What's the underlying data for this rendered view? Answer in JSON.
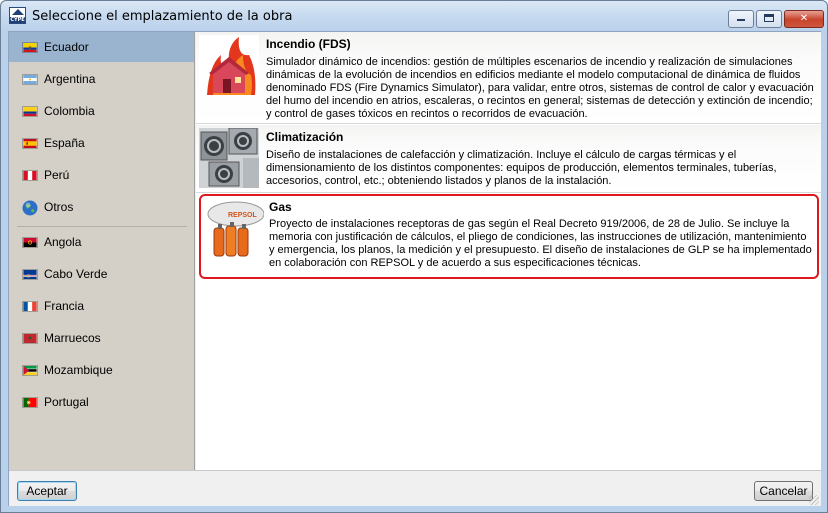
{
  "window": {
    "title": "Seleccione el emplazamiento de la obra",
    "icon": "app-logo-icon",
    "icon_text": "CYPE",
    "buttons": {
      "minimize": "minimize",
      "maximize": "maximize",
      "close": "✕"
    }
  },
  "sidebar": {
    "items": [
      {
        "label": "Ecuador",
        "flag": "ecuador-flag-icon",
        "selected": true
      },
      {
        "label": "Argentina",
        "flag": "argentina-flag-icon"
      },
      {
        "label": "Colombia",
        "flag": "colombia-flag-icon"
      },
      {
        "label": "España",
        "flag": "spain-flag-icon"
      },
      {
        "label": "Perú",
        "flag": "peru-flag-icon"
      },
      {
        "label": "Otros",
        "flag": "globe-icon"
      },
      {
        "label": "Angola",
        "flag": "angola-flag-icon"
      },
      {
        "label": "Cabo Verde",
        "flag": "cape-verde-flag-icon"
      },
      {
        "label": "Francia",
        "flag": "france-flag-icon"
      },
      {
        "label": "Marruecos",
        "flag": "morocco-flag-icon"
      },
      {
        "label": "Mozambique",
        "flag": "mozambique-flag-icon"
      },
      {
        "label": "Portugal",
        "flag": "portugal-flag-icon"
      }
    ]
  },
  "modules": [
    {
      "title": "Incendio (FDS)",
      "icon": "burning-house-icon",
      "description": "Simulador dinámico de incendios: gestión de múltiples escenarios de incendio y realización de simulaciones dinámicas de la evolución de incendios en edificios mediante el modelo computacional de dinámica de fluidos denominado FDS (Fire Dynamics Simulator), para validar, entre otros, sistemas de control de calor y evacuación del humo del incendio en atrios, escaleras, o recintos en general; sistemas de detección y extinción de incendio; y control de gases tóxicos en recintos o recorridos de evacuación."
    },
    {
      "title": "Climatización",
      "icon": "hvac-units-icon",
      "description": "Diseño de instalaciones de calefacción y climatización. Incluye el cálculo de cargas térmicas y el dimensionamiento de los distintos componentes: equipos de producción, elementos terminales, tuberías, accesorios, control, etc.; obteniendo listados y planos de la instalación."
    },
    {
      "title": "Gas",
      "icon": "gas-tank-icon",
      "icon_text": "REPSOL",
      "description": "Proyecto de instalaciones receptoras de gas según el Real Decreto 919/2006, de 28 de Julio. Se incluye la memoria con justificación de cálculos, el pliego de condiciones, las instrucciones de utilización, mantenimiento y emergencia, los planos, la medición y el presupuesto. El diseño de instalaciones de GLP se ha implementado en colaboración con REPSOL y de acuerdo a sus especificaciones técnicas."
    }
  ],
  "footer": {
    "accept_label": "Aceptar",
    "cancel_label": "Cancelar"
  },
  "colors": {
    "selected_item": "#9ab4d0",
    "highlight_border": "#e0181c",
    "sidebar_bg": "#d4d0c8"
  }
}
